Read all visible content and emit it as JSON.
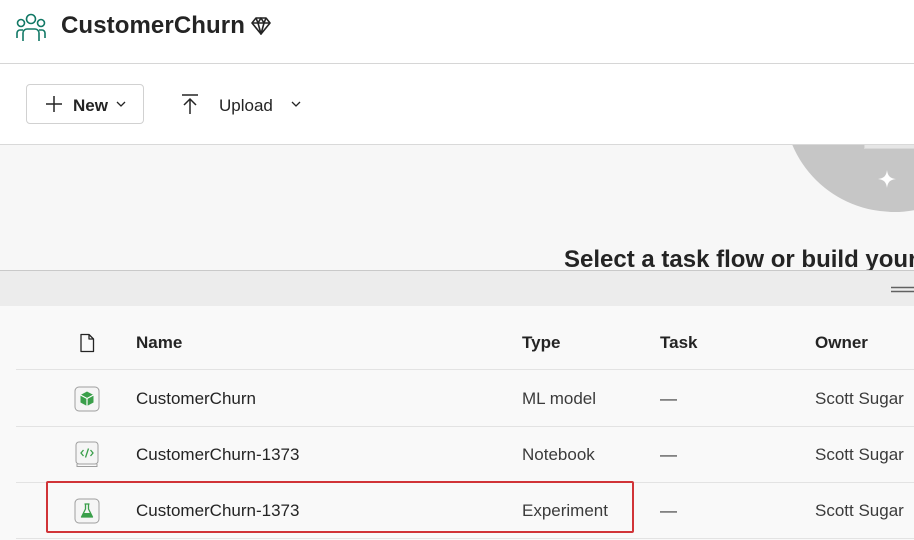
{
  "workspace": {
    "title": "CustomerChurn",
    "icon": "workspace-people-icon",
    "premium_icon": "diamond-icon"
  },
  "toolbar": {
    "new_label": "New",
    "upload_label": "Upload"
  },
  "taskflow": {
    "heading": "Select a task flow or build your"
  },
  "table": {
    "columns": {
      "icon": "file-icon",
      "name": "Name",
      "type": "Type",
      "task": "Task",
      "owner": "Owner"
    },
    "rows": [
      {
        "name": "CustomerChurn",
        "type": "ML model",
        "task": "—",
        "owner": "Scott Sugar",
        "icon": "ml-model-icon"
      },
      {
        "name": "CustomerChurn-1373",
        "type": "Notebook",
        "task": "—",
        "owner": "Scott Sugar",
        "icon": "notebook-icon"
      },
      {
        "name": "CustomerChurn-1373",
        "type": "Experiment",
        "task": "—",
        "owner": "Scott Sugar",
        "icon": "experiment-icon"
      }
    ]
  },
  "colors": {
    "accent_green": "#117865",
    "item_green": "#2e8b3c",
    "highlight_red": "#d13438"
  }
}
